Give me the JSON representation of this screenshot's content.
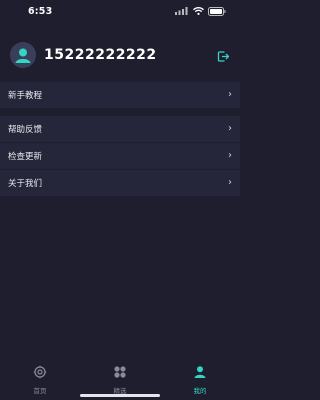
{
  "status_bar": {
    "time": "6:53"
  },
  "profile": {
    "phone": "15222222222",
    "avatar_icon": "user-avatar-icon",
    "logout_icon": "logout-icon"
  },
  "menu": {
    "items": [
      {
        "label": "新手教程",
        "icon": "chevron-right-icon"
      },
      {
        "label": "帮助反馈",
        "icon": "chevron-right-icon"
      },
      {
        "label": "检查更新",
        "icon": "chevron-right-icon"
      },
      {
        "label": "关于我们",
        "icon": "chevron-right-icon"
      }
    ]
  },
  "tabbar": {
    "tabs": [
      {
        "label": "首页",
        "icon": "home-icon",
        "active": false
      },
      {
        "label": "精选",
        "icon": "grid-icon",
        "active": false
      },
      {
        "label": "我的",
        "icon": "person-icon",
        "active": true
      }
    ]
  },
  "colors": {
    "background": "#1f1e2e",
    "row_background": "#26263a",
    "accent": "#35d4c4",
    "inactive": "#8a8a9a"
  }
}
